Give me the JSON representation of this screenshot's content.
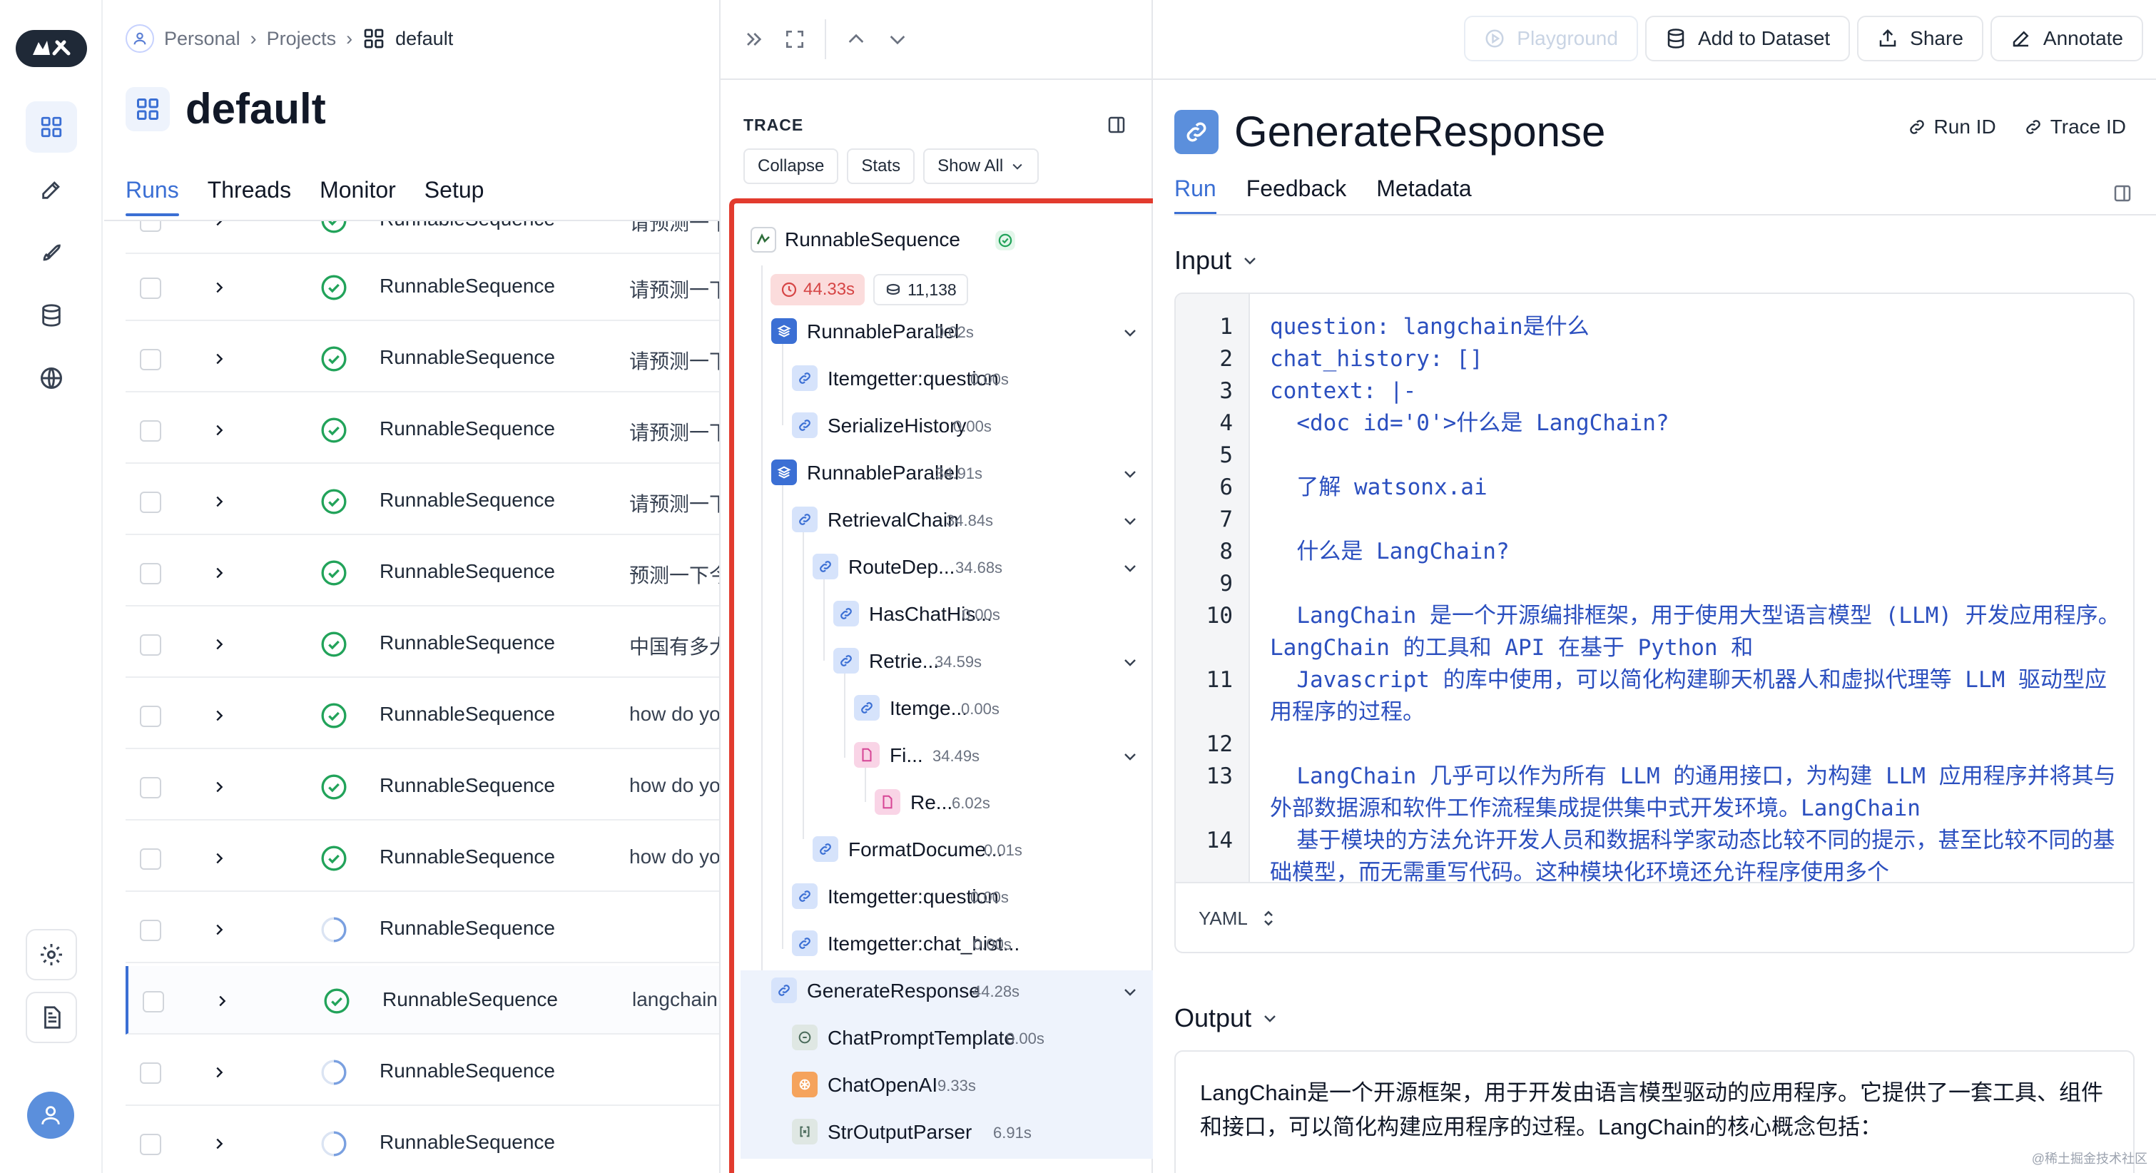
{
  "breadcrumb": {
    "items": [
      "Personal",
      "Projects",
      "default"
    ]
  },
  "project": {
    "title": "default",
    "tabs": [
      "Runs",
      "Threads",
      "Monitor",
      "Setup"
    ],
    "active_tab": "Runs"
  },
  "runs": [
    {
      "name": "RunnableSequence",
      "status": "success",
      "input": "请预测一下"
    },
    {
      "name": "RunnableSequence",
      "status": "success",
      "input": "请预测一下"
    },
    {
      "name": "RunnableSequence",
      "status": "success",
      "input": "请预测一下"
    },
    {
      "name": "RunnableSequence",
      "status": "success",
      "input": "请预测一下"
    },
    {
      "name": "RunnableSequence",
      "status": "success",
      "input": "请预测一下"
    },
    {
      "name": "RunnableSequence",
      "status": "success",
      "input": "预测一下今"
    },
    {
      "name": "RunnableSequence",
      "status": "success",
      "input": "中国有多大"
    },
    {
      "name": "RunnableSequence",
      "status": "success",
      "input": "how do you"
    },
    {
      "name": "RunnableSequence",
      "status": "success",
      "input": "how do you"
    },
    {
      "name": "RunnableSequence",
      "status": "success",
      "input": "how do you"
    },
    {
      "name": "RunnableSequence",
      "status": "pending",
      "input": ""
    },
    {
      "name": "RunnableSequence",
      "status": "success",
      "input": "langchain"
    },
    {
      "name": "RunnableSequence",
      "status": "pending",
      "input": ""
    },
    {
      "name": "RunnableSequence",
      "status": "pending",
      "input": ""
    }
  ],
  "trace": {
    "label": "TRACE",
    "buttons": {
      "collapse": "Collapse",
      "stats": "Stats",
      "show_all": "Show All"
    },
    "root": {
      "name": "RunnableSequence",
      "latency": "44.33s",
      "tokens": "11,138"
    },
    "nodes": [
      {
        "name": "RunnableParallel",
        "latency": "0.02s",
        "icon": "stack-icon"
      },
      {
        "name": "Itemgetter:question",
        "latency": "0.00s",
        "icon": "link-icon"
      },
      {
        "name": "SerializeHistory",
        "latency": "0.00s",
        "icon": "link-icon"
      },
      {
        "name": "RunnableParallel",
        "latency": "34.91s",
        "icon": "stack-icon"
      },
      {
        "name": "RetrievalChain",
        "latency": "34.84s",
        "icon": "link-icon"
      },
      {
        "name": "RouteDep...",
        "latency": "34.68s",
        "icon": "link-icon"
      },
      {
        "name": "HasChatHis...",
        "latency": "0.00s",
        "icon": "link-icon"
      },
      {
        "name": "Retrie...",
        "latency": "34.59s",
        "icon": "link-icon"
      },
      {
        "name": "Itemge...",
        "latency": "0.00s",
        "icon": "link-icon"
      },
      {
        "name": "Fi...",
        "latency": "34.49s",
        "icon": "document-icon"
      },
      {
        "name": "Re...",
        "latency": "6.02s",
        "icon": "document-icon"
      },
      {
        "name": "FormatDocume...",
        "latency": "0.01s",
        "icon": "link-icon"
      },
      {
        "name": "Itemgetter:question",
        "latency": "0.00s",
        "icon": "link-icon"
      },
      {
        "name": "Itemgetter:chat_hist...",
        "latency": "0.00s",
        "icon": "link-icon"
      },
      {
        "name": "GenerateResponse",
        "latency": "44.28s",
        "icon": "link-icon"
      },
      {
        "name": "ChatPromptTemplate",
        "latency": "0.00s",
        "icon": "chat-icon"
      },
      {
        "name": "ChatOpenAI",
        "latency": "9.33s",
        "icon": "openai-icon"
      },
      {
        "name": "StrOutputParser",
        "latency": "6.91s",
        "icon": "parser-icon"
      }
    ]
  },
  "toolbar": {
    "playground": "Playground",
    "add_to_dataset": "Add to Dataset",
    "share": "Share",
    "annotate": "Annotate"
  },
  "detail": {
    "title": "GenerateResponse",
    "run_id": "Run ID",
    "trace_id": "Trace ID",
    "tabs": [
      "Run",
      "Feedback",
      "Metadata"
    ],
    "input_label": "Input",
    "output_label": "Output",
    "format": "YAML",
    "input_lines": [
      {
        "n": "1",
        "text": "question: langchain是什么"
      },
      {
        "n": "2",
        "text": "chat_history: []"
      },
      {
        "n": "3",
        "text": "context: |-"
      },
      {
        "n": "4",
        "text": "  <doc id='0'>什么是 LangChain?"
      },
      {
        "n": "5",
        "text": ""
      },
      {
        "n": "6",
        "text": "  了解 watsonx.ai"
      },
      {
        "n": "7",
        "text": ""
      },
      {
        "n": "8",
        "text": "  什么是 LangChain?"
      },
      {
        "n": "9",
        "text": ""
      },
      {
        "n": "10",
        "text": "  LangChain 是一个开源编排框架，用于使用大型语言模型 (LLM) 开发应用程序。LangChain 的工具和 API 在基于 Python 和"
      },
      {
        "n": "11",
        "text": "  Javascript 的库中使用，可以简化构建聊天机器人和虚拟代理等 LLM 驱动型应用程序的过程。"
      },
      {
        "n": "12",
        "text": ""
      },
      {
        "n": "13",
        "text": "  LangChain 几乎可以作为所有 LLM 的通用接口，为构建 LLM 应用程序并将其与外部数据源和软件工作流程集成提供集中式开发环境。LangChain"
      },
      {
        "n": "14",
        "text": "  基于模块的方法允许开发人员和数据科学家动态比较不同的提示，甚至比较不同的基础模型，而无需重写代码。这种模块化环境还允许程序使用多个"
      }
    ],
    "output_text": "LangChain是一个开源框架，用于开发由语言模型驱动的应用程序。它提供了一套工具、组件和接口，可以简化构建应用程序的过程。LangChain的核心概念包括："
  },
  "watermark": "@稀土掘金技术社区",
  "colors": {
    "accent": "#3b6fd4",
    "success": "#22a35a",
    "highlight_frame": "#e23b2e"
  }
}
